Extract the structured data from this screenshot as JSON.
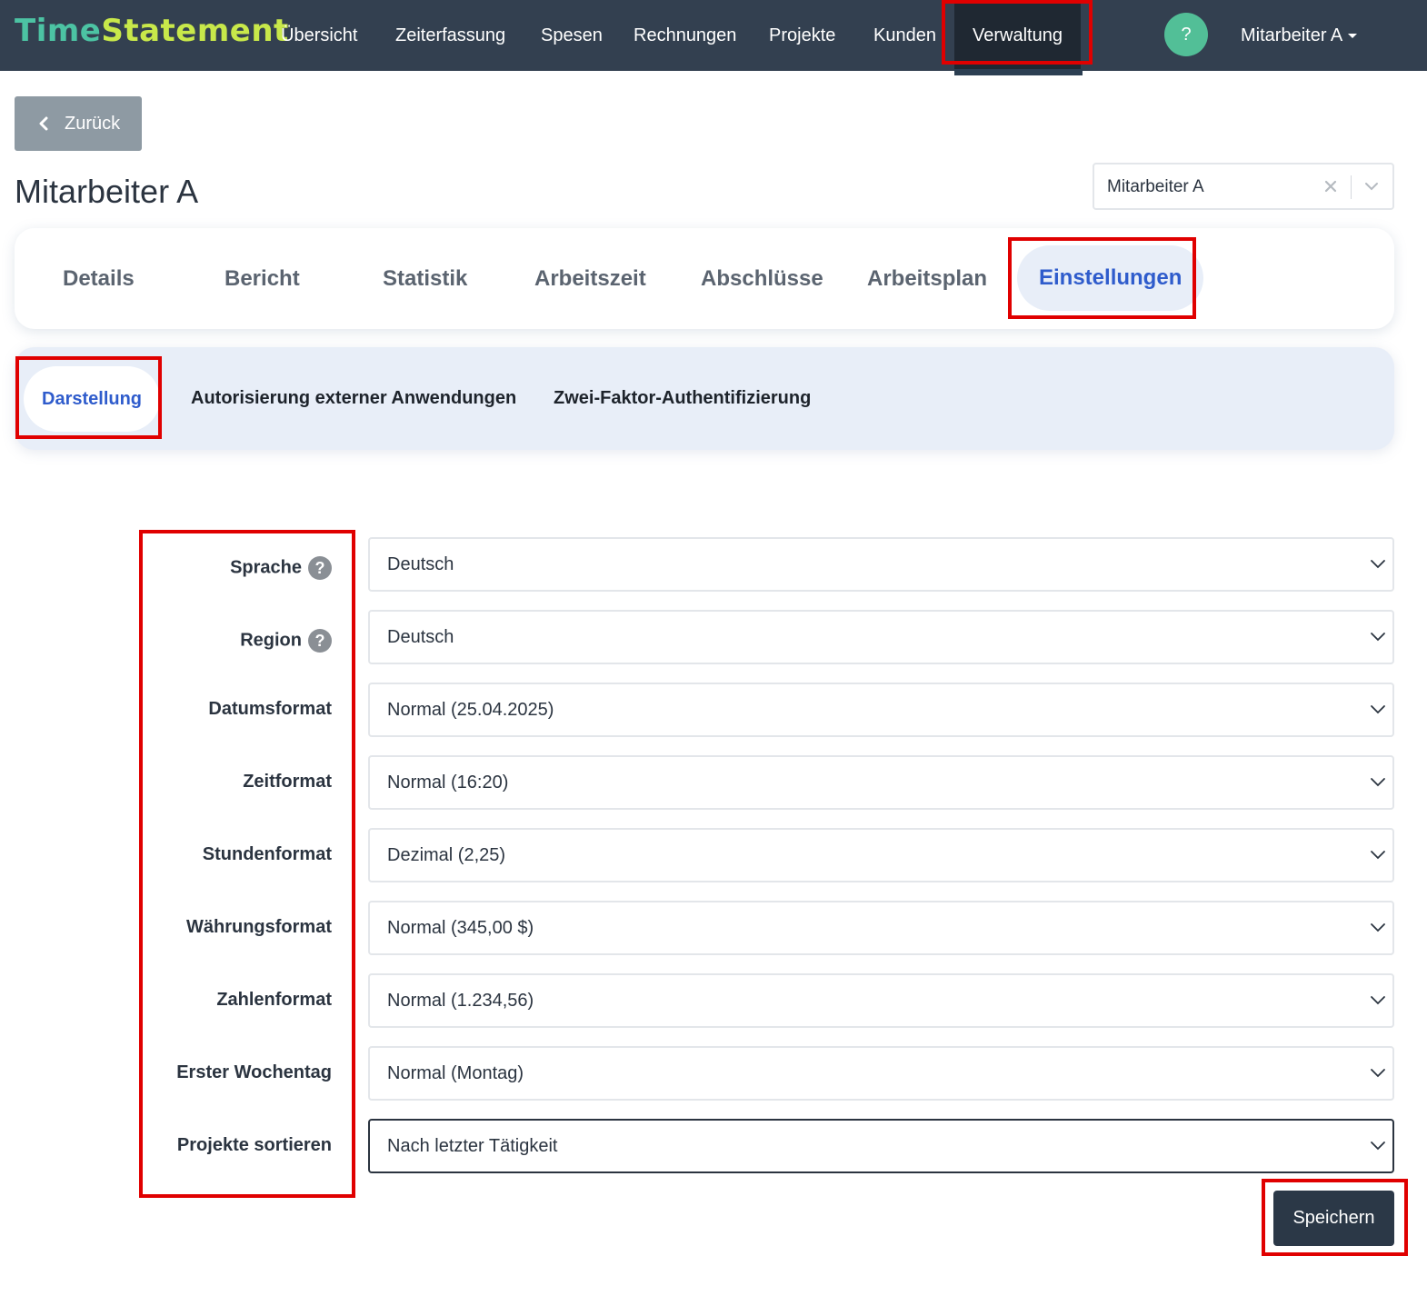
{
  "app": {
    "logo_part1": "Time",
    "logo_part2": "Statement"
  },
  "nav": {
    "items": [
      {
        "label": "Übersicht"
      },
      {
        "label": "Zeiterfassung"
      },
      {
        "label": "Spesen"
      },
      {
        "label": "Rechnungen"
      },
      {
        "label": "Projekte"
      },
      {
        "label": "Kunden"
      },
      {
        "label": "Verwaltung",
        "active": true
      }
    ],
    "help_label": "?",
    "user_label": "Mitarbeiter A"
  },
  "back_button": {
    "label": "Zurück"
  },
  "page_title": "Mitarbeiter A",
  "employee_select": {
    "value": "Mitarbeiter A"
  },
  "tabs": [
    {
      "label": "Details"
    },
    {
      "label": "Bericht"
    },
    {
      "label": "Statistik"
    },
    {
      "label": "Arbeitszeit"
    },
    {
      "label": "Abschlüsse"
    },
    {
      "label": "Arbeitsplan"
    },
    {
      "label": "Einstellungen",
      "active": true
    }
  ],
  "subtabs": [
    {
      "label": "Darstellung",
      "active": true
    },
    {
      "label": "Autorisierung externer Anwendungen"
    },
    {
      "label": "Zwei-Faktor-Authentifizierung"
    }
  ],
  "form": {
    "rows": [
      {
        "label": "Sprache",
        "value": "Deutsch",
        "help": "?"
      },
      {
        "label": "Region",
        "value": "Deutsch",
        "help": "?"
      },
      {
        "label": "Datumsformat",
        "value": "Normal (25.04.2025)"
      },
      {
        "label": "Zeitformat",
        "value": "Normal (16:20)"
      },
      {
        "label": "Stundenformat",
        "value": "Dezimal (2,25)"
      },
      {
        "label": "Währungsformat",
        "value": "Normal (345,00 $)"
      },
      {
        "label": "Zahlenformat",
        "value": "Normal (1.234,56)"
      },
      {
        "label": "Erster Wochentag",
        "value": "Normal (Montag)"
      },
      {
        "label": "Projekte sortieren",
        "value": "Nach letzter Tätigkeit",
        "focused": true
      }
    ],
    "save_label": "Speichern"
  },
  "colors": {
    "navbar": "#334050",
    "accent_blue": "#2f5ccc",
    "logo_teal": "#4cc3a3",
    "logo_lime": "#c8e84a",
    "help_green": "#52bf97",
    "annotation_red": "#e00000"
  }
}
